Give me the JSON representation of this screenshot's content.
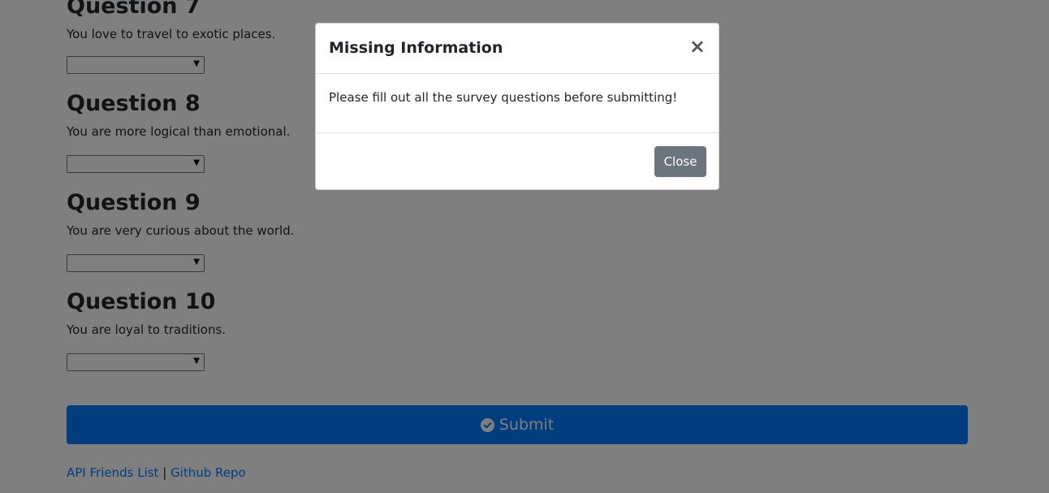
{
  "questions": [
    {
      "title": "Question 7",
      "text": "You love to travel to exotic places."
    },
    {
      "title": "Question 8",
      "text": "You are more logical than emotional."
    },
    {
      "title": "Question 9",
      "text": "You are very curious about the world."
    },
    {
      "title": "Question 10",
      "text": "You are loyal to traditions."
    }
  ],
  "submit": {
    "label": "Submit",
    "icon": "check-circle-icon"
  },
  "footer": {
    "link1": "API Friends List",
    "separator": "|",
    "link2": "Github Repo"
  },
  "modal": {
    "title": "Missing Information",
    "close_symbol": "×",
    "message": "Please fill out all the survey questions before submitting!",
    "close_label": "Close"
  },
  "colors": {
    "primary": "#007bff",
    "secondary": "#6c757d",
    "backdrop": "rgba(0,0,0,0.5)"
  }
}
